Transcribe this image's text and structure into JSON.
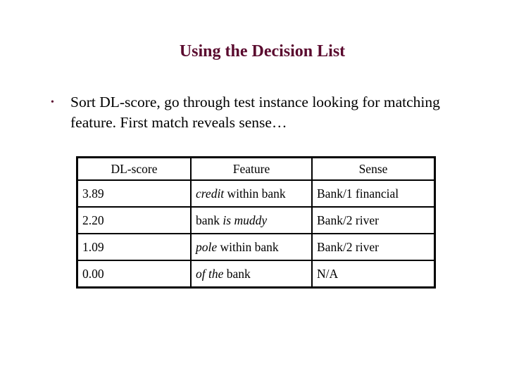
{
  "title": "Using the Decision List",
  "bullet": {
    "marker": "•",
    "text": "Sort DL-score, go through test instance looking for matching feature. First match reveals sense…"
  },
  "table": {
    "headers": [
      "DL-score",
      "Feature",
      "Sense"
    ],
    "rows": [
      {
        "score": "3.89",
        "feature_italic_pre": "credit",
        "feature_plain": " within bank",
        "feature_italic_post": "",
        "sense": "Bank/1 financial"
      },
      {
        "score": "2.20",
        "feature_italic_pre": "",
        "feature_plain": "bank ",
        "feature_italic_post": "is muddy",
        "sense": "Bank/2 river"
      },
      {
        "score": "1.09",
        "feature_italic_pre": "pole",
        "feature_plain": " within bank",
        "feature_italic_post": "",
        "sense": "Bank/2 river"
      },
      {
        "score": "0.00",
        "feature_italic_pre": "of the",
        "feature_plain": " bank",
        "feature_italic_post": "",
        "sense": "N/A"
      }
    ]
  }
}
